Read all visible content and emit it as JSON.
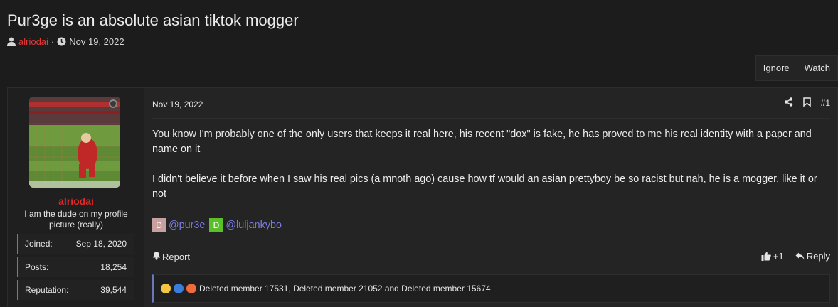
{
  "thread": {
    "title": "Pur3ge is an absolute asian tiktok mogger",
    "author": "alriodai",
    "date": "Nov 19, 2022"
  },
  "thread_buttons": {
    "ignore": "Ignore",
    "watch": "Watch"
  },
  "user": {
    "name": "alriodai",
    "title": "I am the dude on my profile picture (really)",
    "stats": [
      {
        "label": "Joined:",
        "value": "Sep 18, 2020"
      },
      {
        "label": "Posts:",
        "value": "18,254"
      },
      {
        "label": "Reputation:",
        "value": "39,544"
      }
    ]
  },
  "post": {
    "date": "Nov 19, 2022",
    "number": "#1",
    "paragraphs": [
      "You know I'm probably one of the only users that keeps it real here, his recent \"dox\" is fake, he has proved to me his real identity with a paper and name on it",
      "I didn't believe it before when I saw his real pics (a mnoth ago) cause how tf would an asian prettyboy be so racist but nah, he is a mogger, like it or not"
    ],
    "mentions": [
      {
        "badge": "D",
        "badge_color": "#c9a0a0",
        "name": "@pur3e"
      },
      {
        "badge": "D",
        "badge_color": "#5bbf2a",
        "name": "@luljankybo"
      }
    ],
    "report_label": "Report",
    "like_count": "+1",
    "reply_label": "Reply",
    "reactions_text": "Deleted member 17531, Deleted member 21052 and Deleted member 15674"
  },
  "icons": {
    "author": "user-icon",
    "date": "clock-icon",
    "share": "share-icon",
    "bookmark": "bookmark-icon",
    "report": "bell-icon",
    "like": "thumbs-up-icon",
    "reply": "reply-icon"
  },
  "colors": {
    "accent_link": "#e03a3a",
    "mention": "#7a7ae0",
    "stat_border": "#6b77b8"
  }
}
